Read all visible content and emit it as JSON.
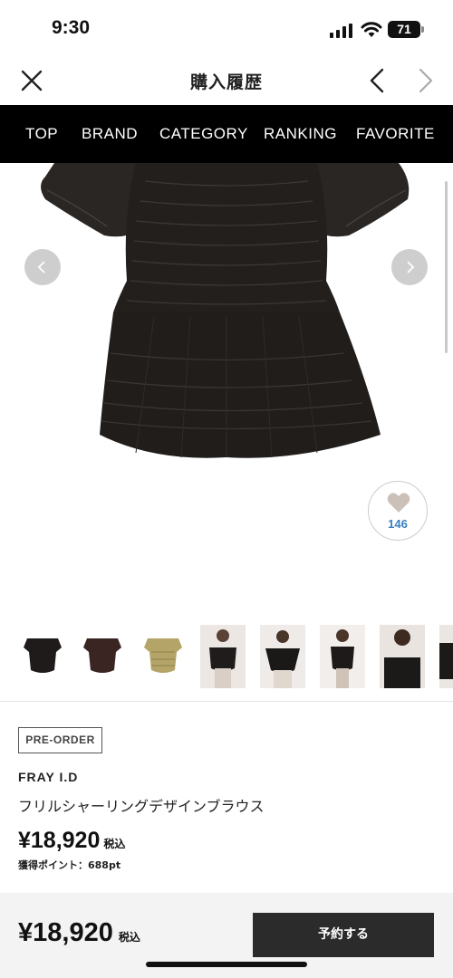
{
  "status_bar": {
    "time": "9:30",
    "battery": "71"
  },
  "header": {
    "title": "購入履歴"
  },
  "nav": {
    "items": [
      "TOP",
      "BRAND",
      "CATEGORY",
      "RANKING",
      "FAVORITE"
    ]
  },
  "favorite": {
    "count": "146"
  },
  "product": {
    "badge": "PRE-ORDER",
    "brand": "FRAY I.D",
    "name": "フリルシャーリングデザインブラウス",
    "price": "¥18,920",
    "tax_label": "税込",
    "points": "獲得ポイント：688pt"
  },
  "bottom_bar": {
    "price": "¥18,920",
    "tax_label": "税込",
    "reserve_label": "予約する"
  },
  "colors": {
    "nav_bg": "#000000",
    "button_bg": "#2b2b2b",
    "fav_count": "#3a7fc4",
    "bottom_bg": "#f3f3f3"
  },
  "icons": [
    "close-icon",
    "chevron-left-icon",
    "chevron-right-icon",
    "heart-icon",
    "signal-icon",
    "wifi-icon",
    "battery-icon"
  ]
}
